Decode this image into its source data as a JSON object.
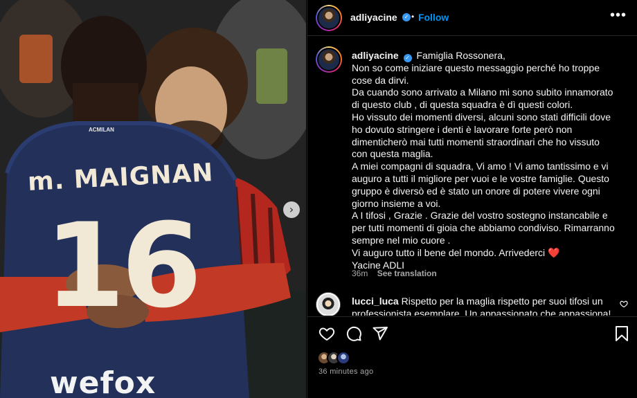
{
  "post": {
    "username": "adliyacine",
    "follow_label": "Follow",
    "more_label": "•••",
    "carousel_next": "›"
  },
  "photo": {
    "jersey_name": "m. MAIGNAN",
    "jersey_number": "16",
    "jersey_brand": "ACMILAN",
    "sponsor": "wefox"
  },
  "caption": {
    "username": "adliyacine",
    "lines": [
      "Famiglia Rossonera,",
      "Non so come iniziare questo messaggio perché ho troppe",
      "cose da dirvi.",
      "Da cuando sono arrivato a Milano mi sono subito innamorato",
      "di questo club , di questa squadra è dì questi colori.",
      "Ho vissuto dei momenti diversi, alcuni sono stati difficili dove",
      "ho dovuto stringere i denti è lavorare forte però non",
      "dimenticherò mai tutti momenti straordinari che ho vissuto",
      "con questa maglia.",
      "A miei compagni di squadra, Vi amo ! Vi amo tantissimo e vi",
      "auguro a tutti il migliore per vuoi e le vostre famiglie. Questo",
      "gruppo è diversò ed è stato un onore di potere vivere ogni",
      "giorno insieme a voi.",
      "A I tifosi , Grazie . Grazie del vostro sostegno instancabile e",
      "per tutti momenti di gioia che abbiamo condiviso. Rimarranno",
      "sempre nel mio cuore .",
      "Vi auguro tutto il bene del mondo. Arrivederci ❤️",
      "Yacine ADLI"
    ],
    "time": "36m",
    "see_translation": "See translation"
  },
  "comment": {
    "username": "lucci_luca",
    "text": "Rispetto per la maglia rispetto per suoi tifosi un professionista esemplare. Un appassionato che appassiona!"
  },
  "footer": {
    "timestamp": "36 minutes ago"
  },
  "colors": {
    "accent": "#0095f6",
    "verified": "#3897f0",
    "background": "#000000",
    "muted": "#a8a8a8",
    "heart": "#ed4956"
  },
  "icons": [
    "heart-icon",
    "comment-icon",
    "share-icon",
    "bookmark-icon",
    "verified-icon",
    "more-icon",
    "chevron-right-icon"
  ]
}
